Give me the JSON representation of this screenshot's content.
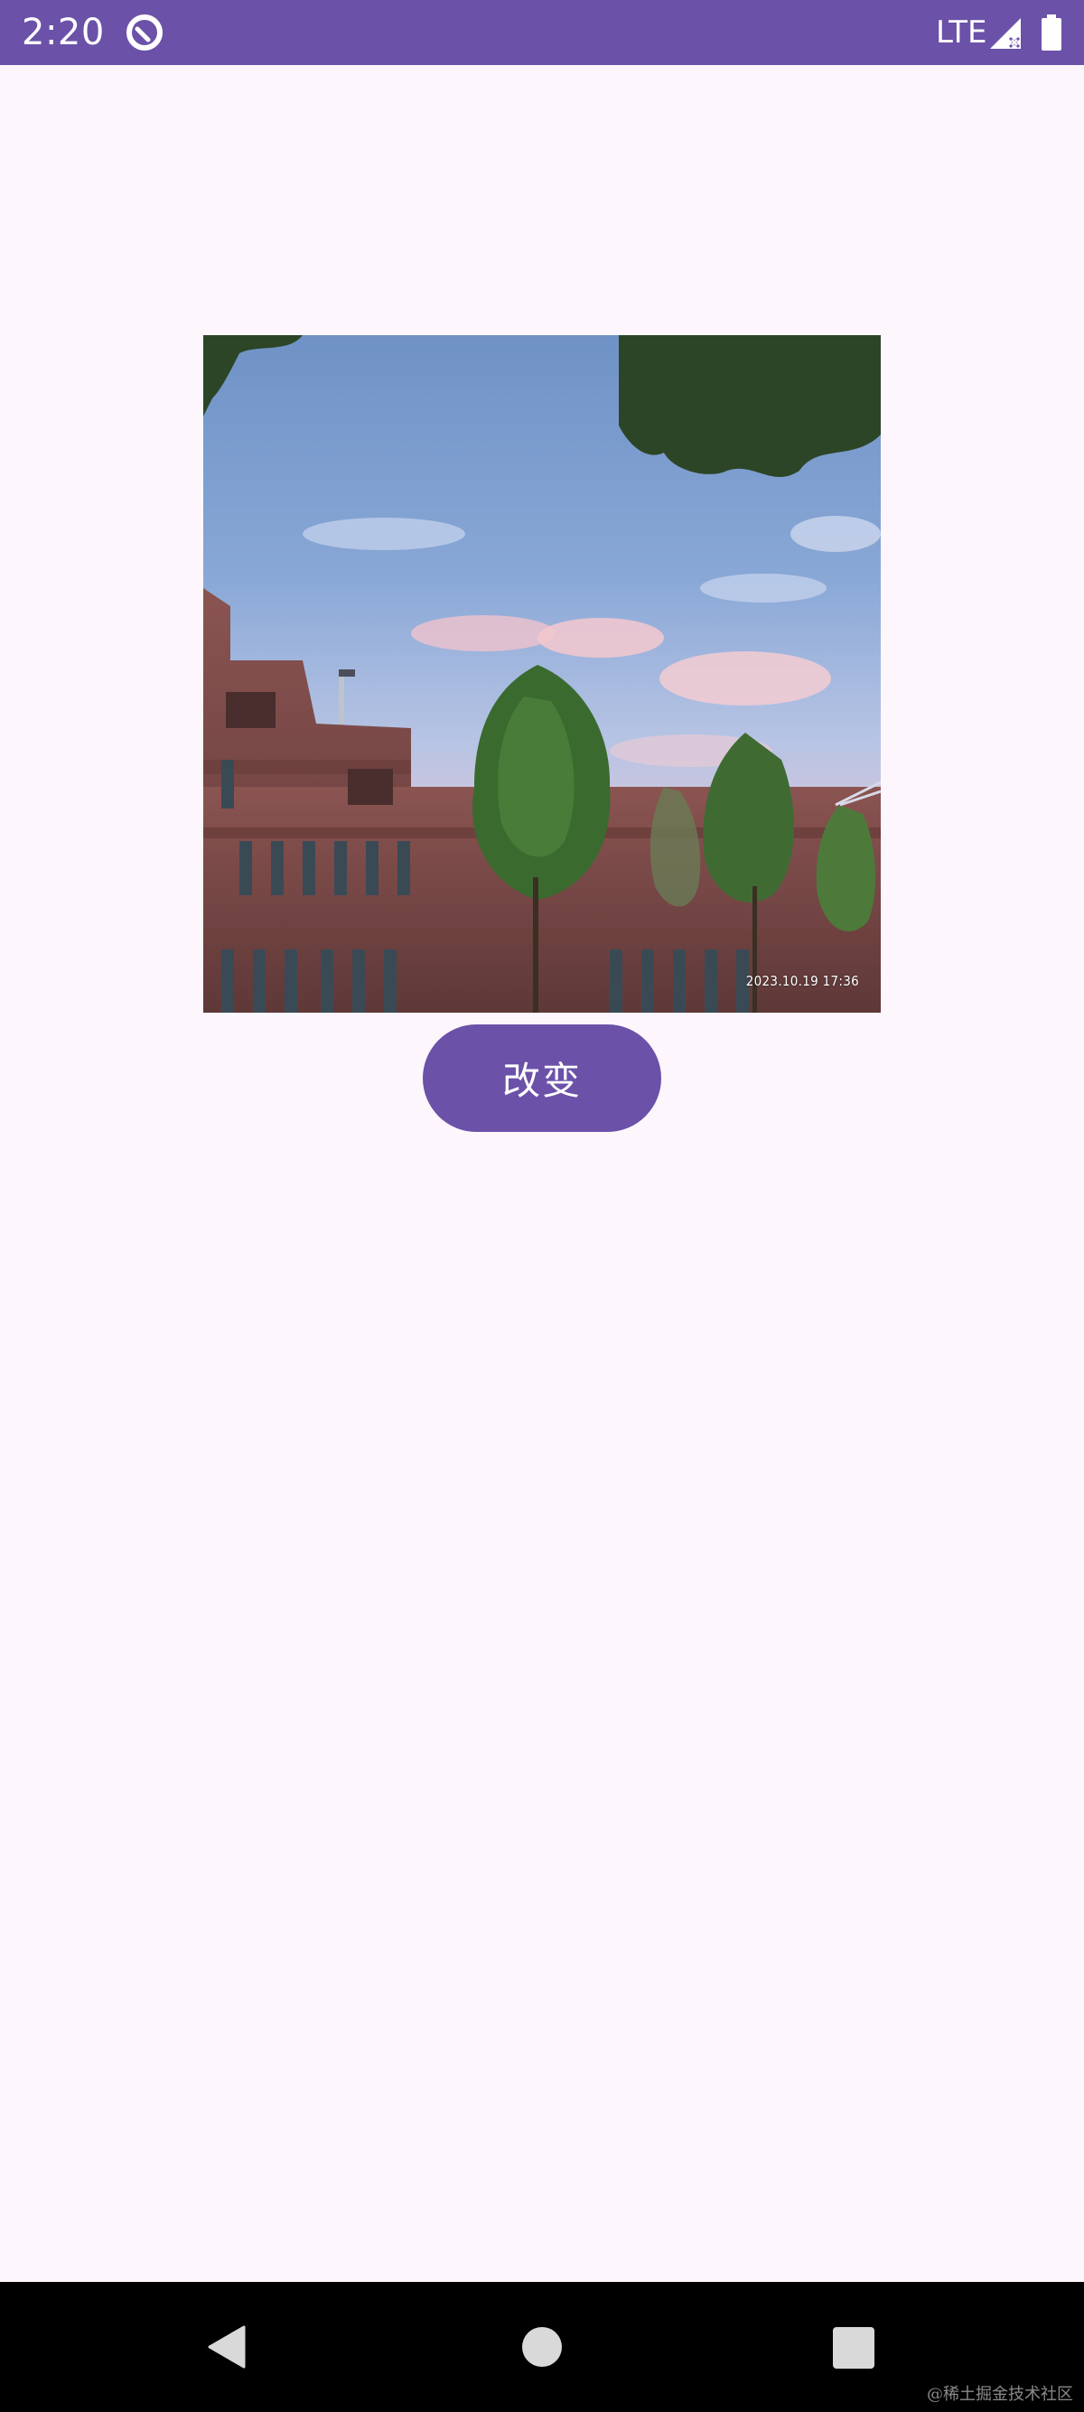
{
  "status_bar": {
    "time": "2:20",
    "app_icon": "app-notification-icon",
    "network": "LTE",
    "signal_icon": "signal-no-service-icon",
    "battery_icon": "battery-full-icon",
    "background_color": "#6b51a8"
  },
  "photo": {
    "timestamp": "2023.10.19   17:36"
  },
  "change_button": {
    "label": "改变",
    "color": "#6b51a8"
  },
  "nav_bar": {
    "back_icon": "back-triangle-icon",
    "home_icon": "home-circle-icon",
    "recents_icon": "recents-square-icon",
    "watermark": "@稀土掘金技术社区"
  },
  "theme": {
    "page_background": "#fdf7fd"
  }
}
